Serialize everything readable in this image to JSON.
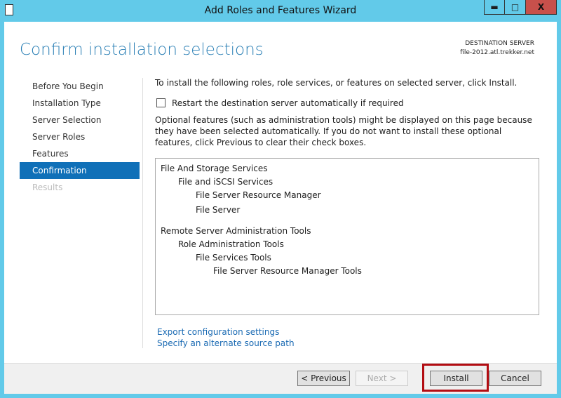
{
  "window": {
    "title": "Add Roles and Features Wizard",
    "minimize": "▬",
    "maximize": "□",
    "close": "X"
  },
  "header": {
    "title": "Confirm installation selections",
    "dest_label": "DESTINATION SERVER",
    "dest_server": "file-2012.atl.trekker.net"
  },
  "nav": [
    {
      "label": "Before You Begin"
    },
    {
      "label": "Installation Type"
    },
    {
      "label": "Server Selection"
    },
    {
      "label": "Server Roles"
    },
    {
      "label": "Features"
    },
    {
      "label": "Confirmation",
      "active": true
    },
    {
      "label": "Results",
      "disabled": true
    }
  ],
  "main": {
    "intro": "To install the following roles, role services, or features on selected server, click Install.",
    "restart_label": "Restart the destination server automatically if required",
    "restart_checked": false,
    "note": "Optional features (such as administration tools) might be displayed on this page because they have been selected automatically. If you do not want to install these optional features, click Previous to clear their check boxes.",
    "items": [
      {
        "label": "File And Storage Services",
        "level": 0
      },
      {
        "label": "File and iSCSI Services",
        "level": 1
      },
      {
        "label": "File Server Resource Manager",
        "level": 2
      },
      {
        "label": "File Server",
        "level": 2
      },
      {
        "label": "",
        "level": 0
      },
      {
        "label": "Remote Server Administration Tools",
        "level": 0
      },
      {
        "label": "Role Administration Tools",
        "level": 1
      },
      {
        "label": "File Services Tools",
        "level": 2
      },
      {
        "label": "File Server Resource Manager Tools",
        "level": 3
      }
    ],
    "export_link": "Export configuration settings",
    "alt_source_link": "Specify an alternate source path"
  },
  "footer": {
    "previous": "< Previous",
    "next": "Next >",
    "install": "Install",
    "cancel": "Cancel"
  }
}
